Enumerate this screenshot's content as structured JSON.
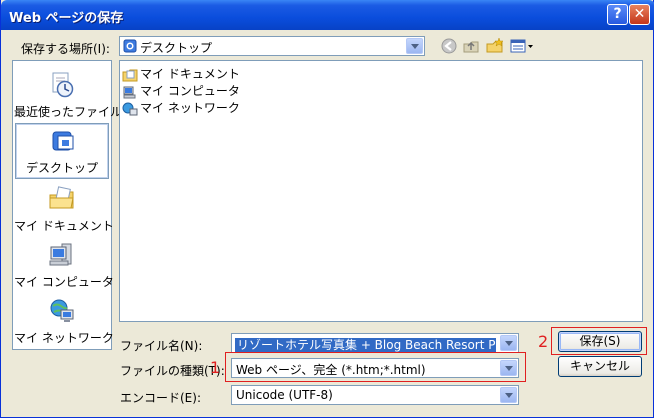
{
  "window": {
    "title": "Web ページの保存",
    "help_glyph": "?",
    "close_glyph": "✕"
  },
  "location": {
    "label": "保存する場所(I):",
    "value": "デスクトップ"
  },
  "places": [
    {
      "label": "最近使ったファイル",
      "icon": "recent-documents-icon"
    },
    {
      "label": "デスクトップ",
      "icon": "desktop-icon"
    },
    {
      "label": "マイ ドキュメント",
      "icon": "my-documents-icon"
    },
    {
      "label": "マイ コンピュータ",
      "icon": "my-computer-icon"
    },
    {
      "label": "マイ ネットワーク",
      "icon": "my-network-icon"
    }
  ],
  "files": [
    {
      "name": "マイ ドキュメント",
      "icon": "my-documents-icon"
    },
    {
      "name": "マイ コンピュータ",
      "icon": "my-computer-icon"
    },
    {
      "name": "マイ ネットワーク",
      "icon": "my-network-icon"
    }
  ],
  "filename": {
    "label": "ファイル名(N):",
    "value": "リゾートホテル写真集 + Blog  Beach Resort Photoclip"
  },
  "filetype": {
    "label": "ファイルの種類(T):",
    "value": "Web ページ、完全 (*.htm;*.html)"
  },
  "encoding": {
    "label": "エンコード(E):",
    "value": "Unicode (UTF-8)"
  },
  "buttons": {
    "save": "保存(S)",
    "cancel": "キャンセル"
  },
  "annotations": {
    "one": "1",
    "two": "2"
  },
  "colors": {
    "title_bar": "#0a4ddc",
    "selection": "#316ac5",
    "annotation": "#e02020"
  }
}
